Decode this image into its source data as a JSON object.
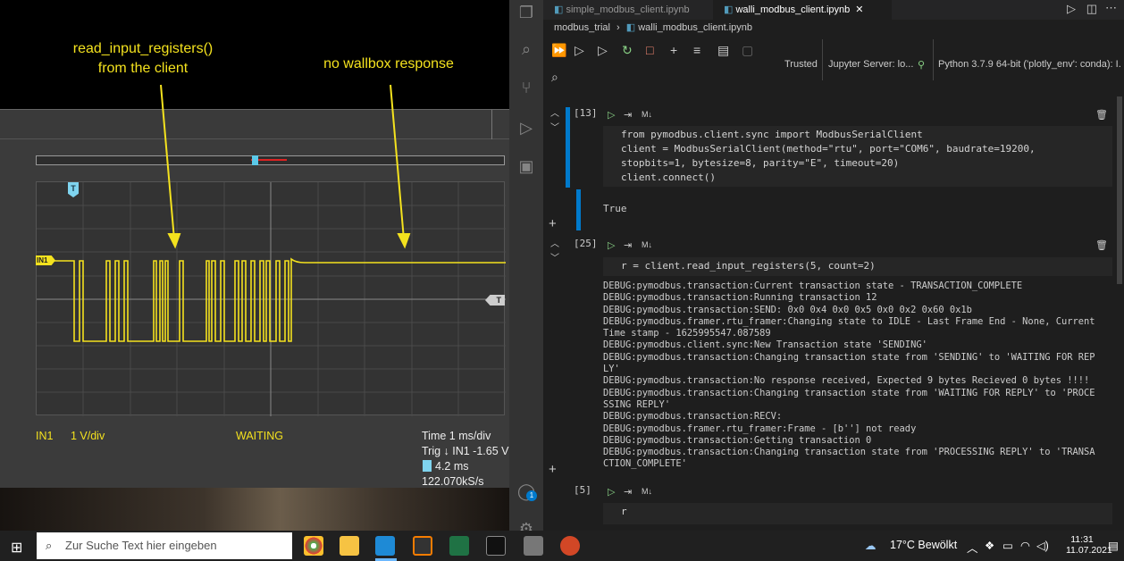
{
  "annotations": {
    "left": "read_input_registers()\nfrom the client",
    "left_line1": "read_input_registers()",
    "left_line2": "from the client",
    "right": "no wallbox response"
  },
  "scope": {
    "channel": "IN1",
    "scale": "1 V/div",
    "state": "WAITING",
    "time": "Time 1 ms/div",
    "trig": "Trig ↓ IN1 -1.65 V",
    "delay": "4.2 ms",
    "rate": "122.070kS/s",
    "ch_marker": "IN1",
    "trig_marker": "T",
    "top_marker": "T"
  },
  "editor": {
    "tabs": [
      "simple_modbus_client.ipynb",
      "walli_modbus_client.ipynb"
    ],
    "breadcrumb": [
      "modbus_trial",
      "walli_modbus_client.ipynb"
    ],
    "trusted": "Trusted",
    "server": "Jupyter Server: lo...",
    "kernel": "Python 3.7.9 64-bit ('plotly_env': conda): I...",
    "cells": [
      {
        "num": "[13]",
        "lang": "M↓"
      },
      {
        "num": "[25]",
        "lang": "M↓"
      },
      {
        "num": "[5]",
        "lang": "M↓"
      }
    ],
    "cell13_code": [
      "from pymodbus.client.sync import ModbusSerialClient",
      "client = ModbusSerialClient(method=\"rtu\", port=\"COM6\", baudrate=19200,",
      "stopbits=1, bytesize=8, parity=\"E\", timeout=20)",
      "client.connect()"
    ],
    "cell13_output": "True",
    "cell25_code": "r = client.read_input_registers(5, count=2)",
    "cell25_output": "DEBUG:pymodbus.transaction:Current transaction state - TRANSACTION_COMPLETE\nDEBUG:pymodbus.transaction:Running transaction 12\nDEBUG:pymodbus.transaction:SEND: 0x0 0x4 0x0 0x5 0x0 0x2 0x60 0x1b\nDEBUG:pymodbus.framer.rtu_framer:Changing state to IDLE - Last Frame End - None, Current\nTime stamp - 1625995547.087589\nDEBUG:pymodbus.client.sync:New Transaction state 'SENDING'\nDEBUG:pymodbus.transaction:Changing transaction state from 'SENDING' to 'WAITING FOR REP\nLY'\nDEBUG:pymodbus.transaction:No response received, Expected 9 bytes Recieved 0 bytes !!!!\nDEBUG:pymodbus.transaction:Changing transaction state from 'WAITING FOR REPLY' to 'PROCE\nSSING REPLY'\nDEBUG:pymodbus.transaction:RECV:\nDEBUG:pymodbus.framer.rtu_framer:Frame - [b''] not ready\nDEBUG:pymodbus.transaction:Getting transaction 0\nDEBUG:pymodbus.transaction:Changing transaction state from 'PROCESSING REPLY' to 'TRANSA\nCTION_COMPLETE'",
    "cell5_code": "r",
    "badge": "1"
  },
  "taskbar": {
    "search_placeholder": "Zur Suche Text hier eingeben",
    "weather": "17°C Bewölkt",
    "time": "11:31",
    "date": "11.07.2021"
  },
  "colors": {
    "signal": "#f4e21e",
    "accent": "#007acc"
  }
}
